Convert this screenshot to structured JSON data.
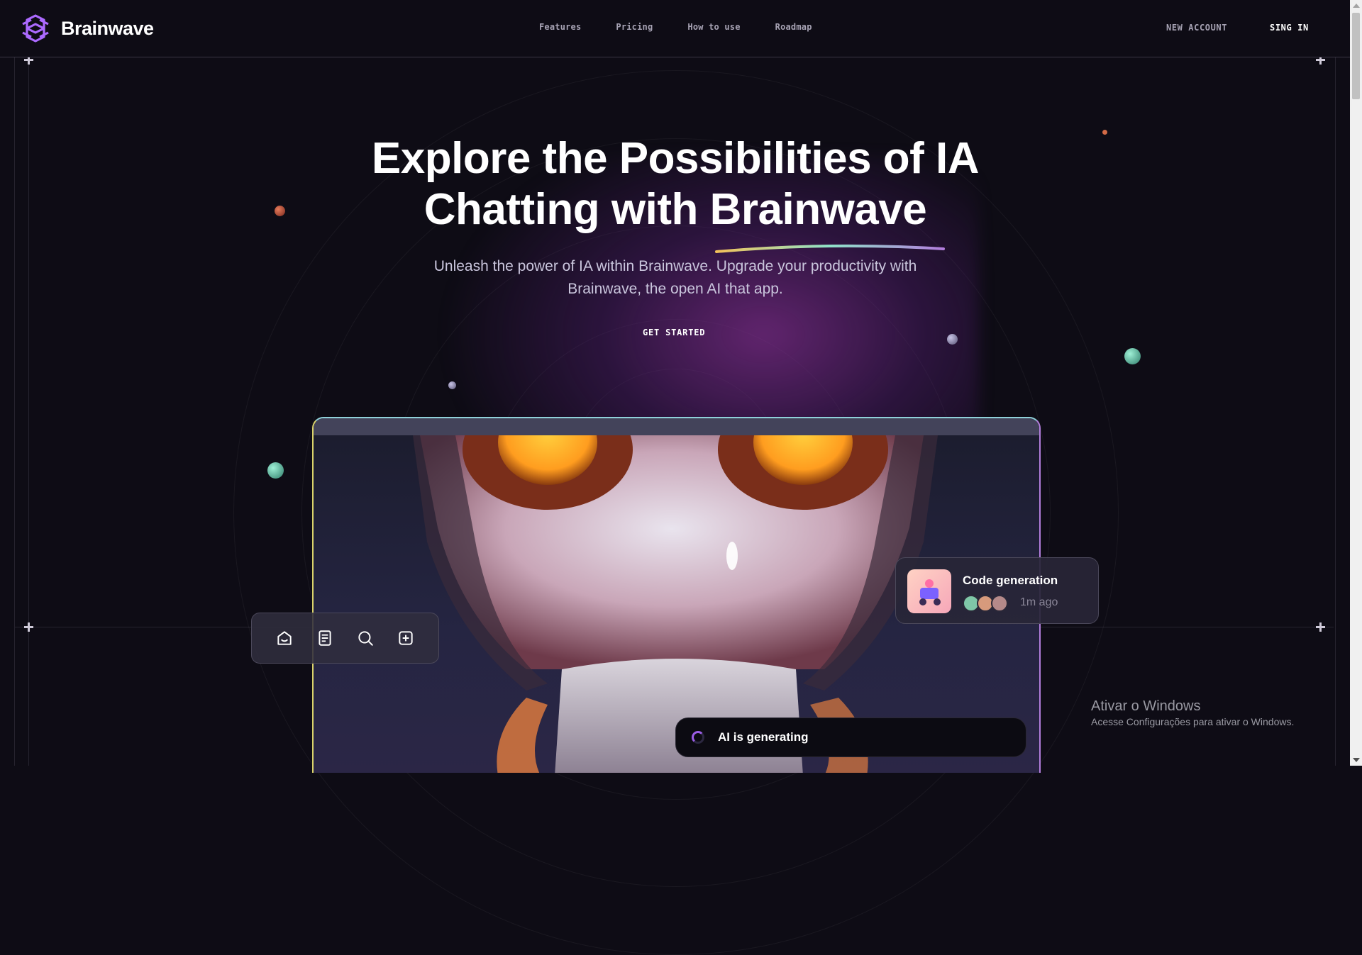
{
  "brand": {
    "name": "Brainwave",
    "logo_icon": "brainwave-logo-icon"
  },
  "nav": {
    "items": [
      {
        "label": "Features"
      },
      {
        "label": "Pricing"
      },
      {
        "label": "How to use"
      },
      {
        "label": "Roadmap"
      }
    ]
  },
  "header": {
    "new_account": "NEW ACCOUNT",
    "sign_in": "SING IN"
  },
  "hero": {
    "title_line1": "Explore the Possibilities of IA",
    "title_line2_prefix": "Chatting with ",
    "title_line2_highlight": "Brainwave",
    "subtitle": "Unleash the power of IA within Brainwave. Upgrade your productivity with Brainwave, the open AI that app.",
    "cta": "GET STARTED"
  },
  "toolbar": {
    "icons": [
      "home-icon",
      "document-icon",
      "search-icon",
      "add-square-icon"
    ]
  },
  "notification": {
    "title": "Code generation",
    "time": "1m ago"
  },
  "status": {
    "generating": "AI is generating"
  },
  "os_watermark": {
    "title": "Ativar o Windows",
    "subtitle": "Acesse Configurações para ativar o Windows."
  },
  "colors": {
    "background": "#0e0c15",
    "accent_purple": "#9b5de5",
    "text_muted": "#a7a3b4",
    "robot_eye": "#ff9d1f"
  }
}
